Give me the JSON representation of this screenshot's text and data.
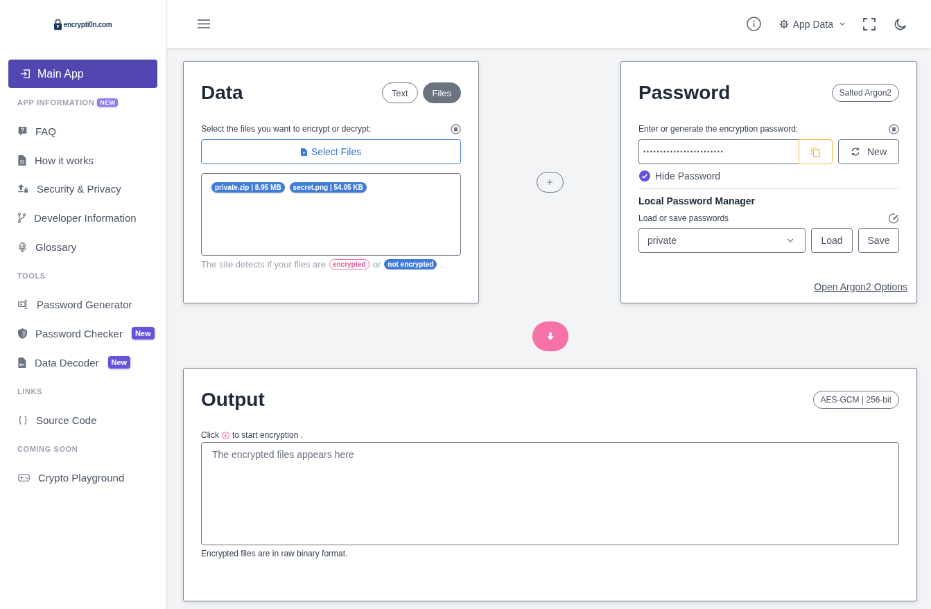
{
  "sidebar": {
    "logo_text": "encrypti0n.com",
    "sections": [
      {
        "links": [
          {
            "label": "Main App",
            "selected": true
          }
        ]
      },
      {
        "title": "APP INFORMATION",
        "badge": "NEW",
        "links": [
          {
            "label": "FAQ",
            "selected": false
          },
          {
            "label": "How it works",
            "selected": false
          },
          {
            "label": "Security & Privacy",
            "selected": false
          },
          {
            "label": "Developer Information",
            "selected": false
          },
          {
            "label": "Glossary",
            "selected": false
          }
        ]
      },
      {
        "title": "TOOLS",
        "links": [
          {
            "label": "Password Generator",
            "selected": false
          },
          {
            "label": "Password Checker",
            "selected": false,
            "badge": "New"
          },
          {
            "label": "Data Decoder",
            "selected": false,
            "badge": "New"
          }
        ]
      },
      {
        "title": "LINKS",
        "links": [
          {
            "label": "Source Code",
            "selected": false
          }
        ]
      },
      {
        "title": "COMING SOON",
        "links": [
          {
            "label": "Crypto Playground",
            "selected": false
          }
        ]
      }
    ]
  },
  "topbar": {
    "settings_label": "App Data"
  },
  "data_panel": {
    "title": "Data",
    "mode_toggle": [
      {
        "label": "Text",
        "selected": false
      },
      {
        "label": "Files",
        "selected": true
      }
    ],
    "instruction": "Select the files you want to encrypt or decrypt:",
    "select_button": "Select Files",
    "files": [
      "private.zip | 8.95 MB",
      "secret.png | 54.05 KB"
    ],
    "detect_note": {
      "lead": "The site detects if your files are",
      "encrypted_tag": "encrypted",
      "joiner": "or",
      "plain_tag": "not encrypted",
      "end": "."
    }
  },
  "password_panel": {
    "title": "Password",
    "algorithm_badge": "Salted Argon2",
    "instruction": "Enter or generate the encryption password:",
    "password_value": "••••••••••••••••••••••••",
    "new_button": "New",
    "hide_password": {
      "label": "Hide Password",
      "checked": true
    },
    "manager": {
      "heading": "Local Password Manager",
      "instruction": "Load or save passwords",
      "selected_entry": "private",
      "load_button": "Load",
      "save_button": "Save"
    },
    "options_link": "Open Argon2 Options"
  },
  "output_panel": {
    "title": "Output",
    "cipher_badge": "AES-GCM | 256-bit",
    "hint": {
      "lead": "Click",
      "tail": "to start encryption ."
    },
    "placeholder": "The encrypted files appears here",
    "footnote": "Encrypted files are in raw binary format."
  }
}
